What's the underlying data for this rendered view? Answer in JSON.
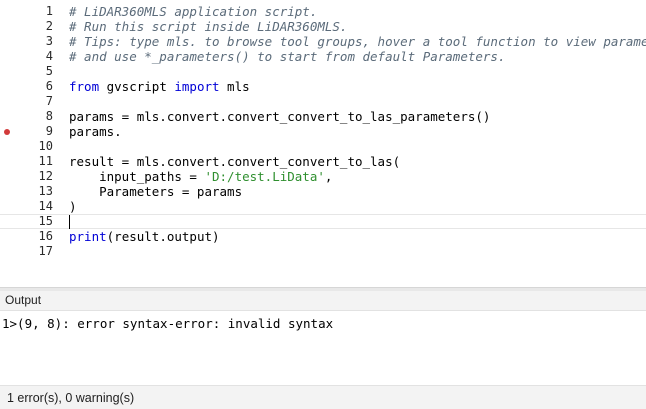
{
  "editor": {
    "lines": [
      {
        "n": "1",
        "parts": [
          {
            "t": "# LiDAR360MLS application script.",
            "c": "cmt"
          }
        ]
      },
      {
        "n": "2",
        "parts": [
          {
            "t": "# Run this script inside LiDAR360MLS.",
            "c": "cmt"
          }
        ]
      },
      {
        "n": "3",
        "parts": [
          {
            "t": "# Tips: type mls. to browse tool groups, hover a tool function to view parameters,",
            "c": "cmt"
          }
        ]
      },
      {
        "n": "4",
        "parts": [
          {
            "t": "# and use *_parameters() to start from default Parameters.",
            "c": "cmt"
          }
        ]
      },
      {
        "n": "5",
        "parts": []
      },
      {
        "n": "6",
        "parts": [
          {
            "t": "from",
            "c": "kw"
          },
          {
            "t": " gvscript ",
            "c": ""
          },
          {
            "t": "import",
            "c": "kw"
          },
          {
            "t": " mls",
            "c": ""
          }
        ]
      },
      {
        "n": "7",
        "parts": []
      },
      {
        "n": "8",
        "parts": [
          {
            "t": "params = mls.convert.convert_convert_to_las_parameters()",
            "c": ""
          }
        ]
      },
      {
        "n": "9",
        "parts": [
          {
            "t": "params.",
            "c": ""
          }
        ],
        "breakpoint": true
      },
      {
        "n": "10",
        "parts": []
      },
      {
        "n": "11",
        "parts": [
          {
            "t": "result = mls.convert.convert_convert_to_las(",
            "c": ""
          }
        ]
      },
      {
        "n": "12",
        "parts": [
          {
            "t": "    input_paths = ",
            "c": ""
          },
          {
            "t": "'D:/test.LiData'",
            "c": "str"
          },
          {
            "t": ",",
            "c": ""
          }
        ]
      },
      {
        "n": "13",
        "parts": [
          {
            "t": "    Parameters = params",
            "c": ""
          }
        ]
      },
      {
        "n": "14",
        "parts": [
          {
            "t": ")",
            "c": ""
          }
        ]
      },
      {
        "n": "15",
        "parts": [],
        "current": true
      },
      {
        "n": "16",
        "parts": [
          {
            "t": "print",
            "c": "kw"
          },
          {
            "t": "(result.output)",
            "c": ""
          }
        ]
      },
      {
        "n": "17",
        "parts": []
      }
    ]
  },
  "output": {
    "title": "Output",
    "lines": [
      "1>(9, 8): error syntax-error: invalid syntax"
    ]
  },
  "status": {
    "summary": "1 error(s), 0 warning(s)"
  },
  "colors": {
    "comment": "#5b6b7a",
    "keyword": "#0000d6",
    "string": "#2f8f2f",
    "breakpoint": "#d23a3a"
  }
}
